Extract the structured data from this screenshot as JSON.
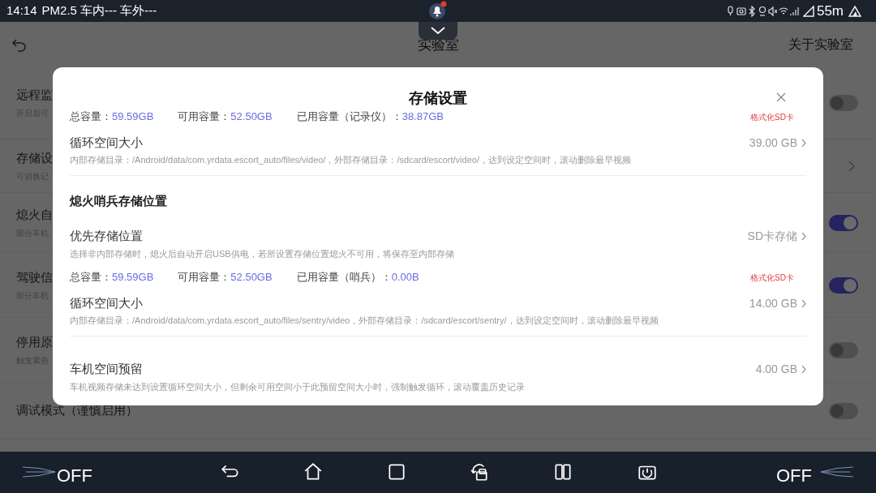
{
  "status_bar": {
    "time": "14:14",
    "info": "PM2.5 车内--- 车外---",
    "reading": "55m"
  },
  "header": {
    "title": "实验室",
    "action": "关于实验室"
  },
  "background_settings": [
    {
      "title": "远程监",
      "subtitle": "开启后可",
      "kind": "toggle",
      "on": false
    },
    {
      "title": "存储设",
      "subtitle": "可切换记",
      "kind": "link"
    },
    {
      "title": "熄火自",
      "subtitle": "部分车机",
      "kind": "toggle",
      "on": true
    },
    {
      "title": "驾驶信",
      "subtitle": "部分车机",
      "kind": "toggle",
      "on": true
    },
    {
      "title": "停用原",
      "subtitle": "触发紧急",
      "kind": "toggle",
      "on": false
    },
    {
      "title": "调试模式（谨慎启用）",
      "kind": "toggle",
      "on": false
    }
  ],
  "dialog": {
    "title": "存储设置",
    "groups": [
      {
        "items": [
          {
            "kind": "stats",
            "stats": [
              {
                "label": "总容量：",
                "value": "59.59GB"
              },
              {
                "label": "可用容量：",
                "value": "52.50GB"
              },
              {
                "label": "已用容量（记录仪）：",
                "value": "38.87GB"
              }
            ],
            "action": "格式化SD卡"
          },
          {
            "kind": "setting",
            "title": "循环空间大小",
            "value": "39.00 GB",
            "description": "内部存储目录：/Android/data/com.yrdata.escort_auto/files/video/，外部存储目录：/sdcard/escort/video/，达到设定空间时，滚动删除最早视频"
          }
        ]
      },
      {
        "heading": "熄火哨兵存储位置",
        "items": [
          {
            "kind": "setting",
            "title": "优先存储位置",
            "value": "SD卡存储",
            "description": "选择非内部存储时，熄火后自动开启USB供电，若所设置存储位置熄火不可用，将保存至内部存储"
          },
          {
            "kind": "stats",
            "stats": [
              {
                "label": "总容量：",
                "value": "59.59GB"
              },
              {
                "label": "可用容量：",
                "value": "52.50GB"
              },
              {
                "label": "已用容量（哨兵）：",
                "value": "0.00B"
              }
            ],
            "action": "格式化SD卡"
          },
          {
            "kind": "setting",
            "title": "循环空间大小",
            "value": "14.00 GB",
            "description": "内部存储目录：/Android/data/com.yrdata.escort_auto/files/sentry/video，外部存储目录：/sdcard/escort/sentry/，达到设定空间时，滚动删除最早视频"
          }
        ]
      },
      {
        "items": [
          {
            "kind": "setting",
            "title": "车机空间预留",
            "value": "4.00 GB",
            "description": "车机视频存储未达到设置循环空间大小，但剩余可用空间小于此预留空间大小时，强制触发循环，滚动覆盖历史记录"
          }
        ]
      }
    ]
  },
  "bottom_bar": {
    "left_label": "OFF",
    "right_label": "OFF"
  }
}
